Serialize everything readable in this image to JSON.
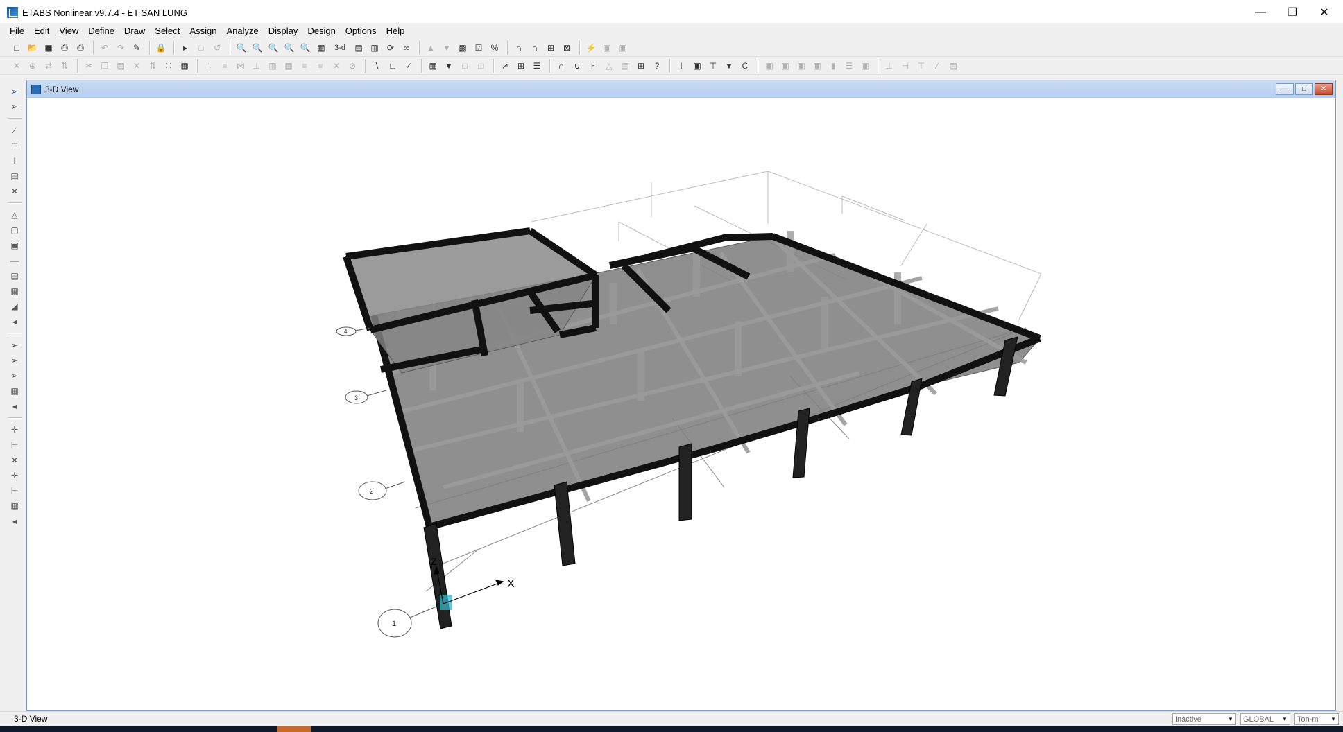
{
  "window": {
    "title": "ETABS Nonlinear v9.7.4 - ET SAN LUNG"
  },
  "menu": [
    {
      "label": "File",
      "key": "F",
      "rest": "ile"
    },
    {
      "label": "Edit",
      "key": "E",
      "rest": "dit"
    },
    {
      "label": "View",
      "key": "V",
      "rest": "iew"
    },
    {
      "label": "Define",
      "key": "D",
      "rest": "efine"
    },
    {
      "label": "Draw",
      "key": "D",
      "rest": "raw"
    },
    {
      "label": "Select",
      "key": "S",
      "rest": "elect"
    },
    {
      "label": "Assign",
      "key": "A",
      "rest": "ssign"
    },
    {
      "label": "Analyze",
      "key": "A",
      "rest": "nalyze"
    },
    {
      "label": "Display",
      "key": "D",
      "rest": "isplay"
    },
    {
      "label": "Design",
      "key": "D",
      "rest": "esign"
    },
    {
      "label": "Options",
      "key": "O",
      "rest": "ptions"
    },
    {
      "label": "Help",
      "key": "H",
      "rest": "elp"
    }
  ],
  "toolbar": {
    "view3d_label": "3-d"
  },
  "view_window": {
    "title": "3-D View"
  },
  "model": {
    "axis_x_label": "X",
    "axis_z_label": "Z",
    "grid_bubbles": [
      "1",
      "2",
      "3",
      "4"
    ]
  },
  "statusbar": {
    "left_text": "3-D View",
    "state": "Inactive",
    "coord_system": "GLOBAL",
    "units": "Ton-m"
  },
  "colors": {
    "slab": "#7d7d7d",
    "beam": "#111111",
    "selection": "#38b6c8",
    "view_titlebar": "#c0d6f2"
  }
}
